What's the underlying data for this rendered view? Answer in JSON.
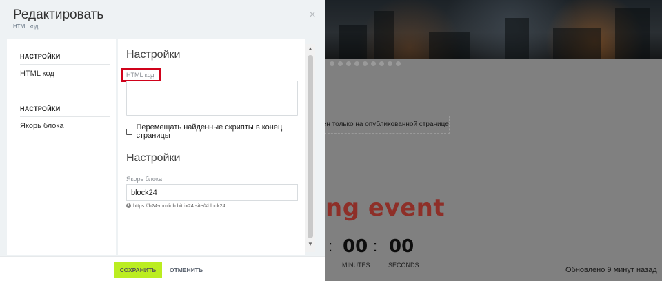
{
  "modal": {
    "title": "Редактировать",
    "subtitle": "HTML код",
    "close_icon": "×"
  },
  "sidebar": {
    "sections": [
      {
        "heading": "НАСТРОЙКИ",
        "item": "HTML код"
      },
      {
        "heading": "НАСТРОЙКИ",
        "item": "Якорь блока"
      }
    ]
  },
  "content": {
    "section1_title": "Настройки",
    "html_label": "HTML код",
    "html_value": "",
    "move_scripts_label": "Перемещать найденные скрипты в конец страницы",
    "move_scripts_checked": false,
    "section2_title": "Настройки",
    "anchor_label": "Якорь блока",
    "anchor_value": "block24",
    "anchor_hint": "https://b24-mmlidb.bitrix24.site/#block24"
  },
  "footer": {
    "save_label": "СОХРАНИТЬ",
    "cancel_label": "ОТМЕНИТЬ"
  },
  "background": {
    "notice": "ден только на опубликованной странице.",
    "event_text": "ng event",
    "countdown": {
      "minutes_value": "00",
      "seconds_value": "00",
      "separator": ":",
      "minutes_label": "MINUTES",
      "seconds_label": "SECONDS"
    },
    "updated_text": "Обновлено 9 минут назад"
  },
  "colors": {
    "accent_save": "#bbed21",
    "highlight": "#d0021b",
    "event_red": "#8e2f28"
  }
}
